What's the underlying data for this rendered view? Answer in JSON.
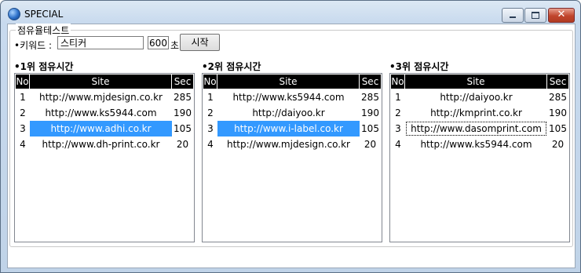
{
  "window": {
    "title": "SPECIAL",
    "icon": "app-globe-icon"
  },
  "controls": {
    "minimize": "minimize-icon",
    "maximize": "maximize-icon",
    "close": "close-icon",
    "close_glyph": "✕"
  },
  "group": {
    "label": "점유율테스트"
  },
  "keyword": {
    "label": "•키워드 :",
    "value": "스티커"
  },
  "seconds": {
    "value": "600",
    "unit": "초"
  },
  "start_button": {
    "label": "시작"
  },
  "columns": {
    "no": "No",
    "site": "Site",
    "sec": "Sec"
  },
  "panels": [
    {
      "title": "•1위 점유시간",
      "rows": [
        {
          "no": "1",
          "site": "http://www.mjdesign.co.kr",
          "sec": "285"
        },
        {
          "no": "2",
          "site": "http://www.ks5944.com",
          "sec": "190"
        },
        {
          "no": "3",
          "site": "http://www.adhi.co.kr",
          "sec": "105"
        },
        {
          "no": "4",
          "site": "http://www.dh-print.co.kr",
          "sec": "20"
        }
      ],
      "selected_row": 3
    },
    {
      "title": "•2위 점유시간",
      "rows": [
        {
          "no": "1",
          "site": "http://www.ks5944.com",
          "sec": "285"
        },
        {
          "no": "2",
          "site": "http://daiyoo.kr",
          "sec": "190"
        },
        {
          "no": "3",
          "site": "http://www.i-label.co.kr",
          "sec": "105"
        },
        {
          "no": "4",
          "site": "http://www.mjdesign.co.kr",
          "sec": "20"
        }
      ],
      "selected_row": 3
    },
    {
      "title": "•3위 점유시간",
      "rows": [
        {
          "no": "1",
          "site": "http://daiyoo.kr",
          "sec": "285"
        },
        {
          "no": "2",
          "site": "http://kmprint.co.kr",
          "sec": "190"
        },
        {
          "no": "3",
          "site": "http://www.dasomprint.com",
          "sec": "105"
        },
        {
          "no": "4",
          "site": "http://www.ks5944.com",
          "sec": "20"
        }
      ],
      "focused_row": 3
    }
  ],
  "colors": {
    "selection": "#3399ff",
    "header_bg": "#000000"
  }
}
